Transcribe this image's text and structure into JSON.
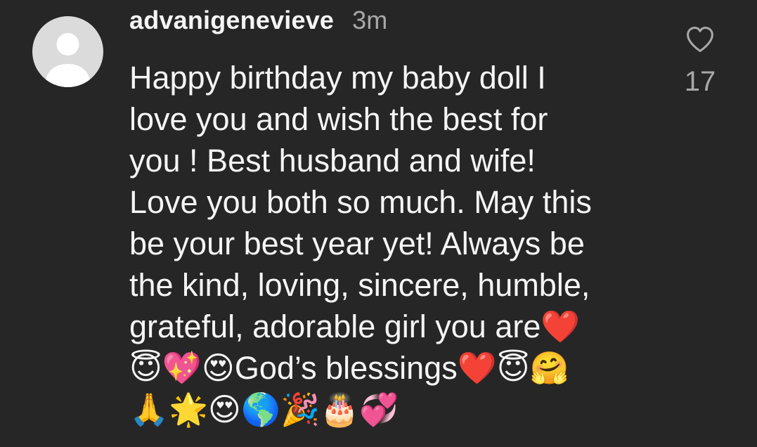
{
  "comment": {
    "username": "advanigenevieve",
    "timestamp": "3m",
    "text": "Happy birthday my baby doll I\nlove you and wish the best for\nyou ! Best husband and wife!\nLove you both so much. May this\nbe your best year yet! Always be\nthe kind, loving, sincere, humble,\ngrateful, adorable girl you are❤️\n😇💖😍God’s blessings❤️😇🤗\n🙏🌟😍🌎🎉🎂💞",
    "like_count": "17",
    "avatar_icon": "default-avatar-icon",
    "like_icon": "heart-outline-icon"
  },
  "colors": {
    "background": "#262626",
    "primary_text": "#f5f5f5",
    "secondary_text": "#a8a8a8",
    "avatar_bg": "#dbdbdb"
  }
}
